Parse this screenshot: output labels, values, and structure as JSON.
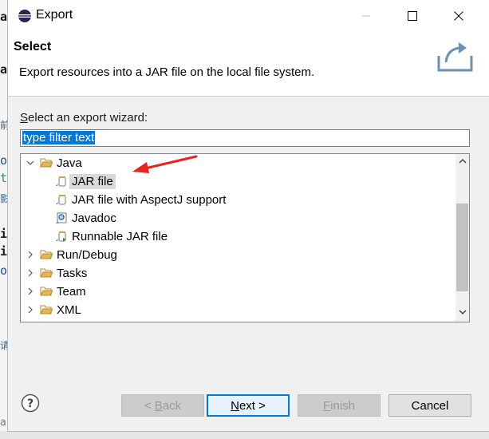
{
  "window": {
    "title": "Export"
  },
  "header": {
    "title": "Select",
    "description": "Export resources into a JAR file on the local file system."
  },
  "body": {
    "wizard_label_first": "S",
    "wizard_label_rest": "elect an export wizard:",
    "filter_value": "type filter text"
  },
  "tree": {
    "items": [
      {
        "label": "Java",
        "expanded": true,
        "icon": "folder-open-icon"
      },
      {
        "label": "JAR file",
        "icon": "jar-file-icon",
        "selected": true
      },
      {
        "label": "JAR file with AspectJ support",
        "icon": "jar-file-icon"
      },
      {
        "label": "Javadoc",
        "icon": "javadoc-icon"
      },
      {
        "label": "Runnable JAR file",
        "icon": "runnable-jar-icon"
      },
      {
        "label": "Run/Debug",
        "expanded": false,
        "icon": "folder-icon"
      },
      {
        "label": "Tasks",
        "expanded": false,
        "icon": "folder-icon"
      },
      {
        "label": "Team",
        "expanded": false,
        "icon": "folder-icon"
      },
      {
        "label": "XML",
        "expanded": false,
        "icon": "folder-icon"
      }
    ]
  },
  "buttons": {
    "back_prefix": "< ",
    "back_mnemonic": "B",
    "back_rest": "ack",
    "next_mnemonic": "N",
    "next_rest": "ext >",
    "finish_mnemonic": "F",
    "finish_rest": "inish",
    "cancel": "Cancel"
  },
  "background_fragments": [
    "a",
    "a",
    "前",
    "o",
    "t",
    "影",
    "i",
    "i",
    "o",
    "请",
    "a"
  ],
  "colors": {
    "accent": "#0078d7",
    "annotation_arrow": "#e8231f",
    "folder": "#e6b656"
  }
}
